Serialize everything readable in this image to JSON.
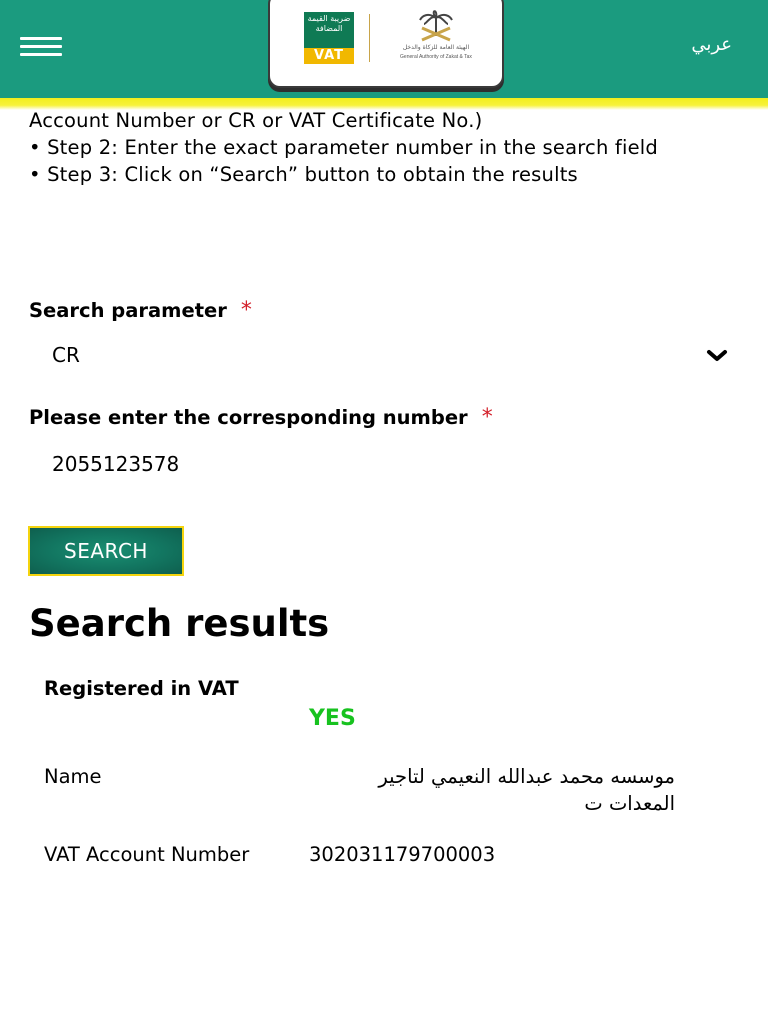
{
  "header": {
    "lang_toggle": "عربي",
    "vat_logo_arabic": "ضريبة القيمة المضافة",
    "vat_logo_text": "VAT",
    "authority_arabic": "الهيئة العامة للزكاة والدخل",
    "authority_english": "General Authority of Zakat & Tax",
    "colors": {
      "header_bg": "#1b9b7f",
      "stripe": "#f2ee1c"
    }
  },
  "instructions": {
    "line1": "Account Number or CR or VAT Certificate No.)",
    "step2": "• Step 2: Enter the exact parameter number in the search field",
    "step3": "• Step 3: Click on “Search” button to obtain the results"
  },
  "form": {
    "search_parameter_label": "Search parameter",
    "required_mark": "*",
    "search_parameter_value": "CR",
    "number_label": "Please enter the corresponding number",
    "number_value": "2055123578",
    "search_button": "SEARCH"
  },
  "results": {
    "title": "Search results",
    "registered_label": "Registered in VAT",
    "registered_value": "YES",
    "name_label": "Name",
    "name_value": "موسسه محمد عبدالله النعيمي لتاجير المعدات ت",
    "account_label": "VAT Account Number",
    "account_value": "302031179700003"
  },
  "icons": [
    "hamburger-menu-icon",
    "chevron-down-icon",
    "vat-logo",
    "zakat-authority-logo"
  ]
}
